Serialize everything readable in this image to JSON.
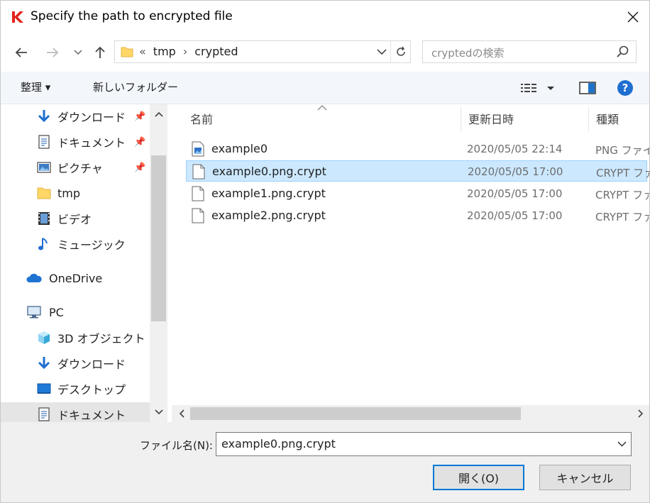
{
  "window": {
    "title": "Specify the path to encrypted file",
    "logo_color": "#e2231a",
    "accent_color": "#0078d7",
    "selection_color": "#cce8ff"
  },
  "nav": {
    "back_icon": "arrow-left-icon",
    "forward_icon": "arrow-right-icon",
    "recent_icon": "chevron-down-icon",
    "up_icon": "arrow-up-icon",
    "path_overflow": "«",
    "path": [
      "tmp",
      "crypted"
    ],
    "path_separator": "›",
    "refresh_icon": "refresh-icon",
    "search_placeholder": "cryptedの検索"
  },
  "toolbar": {
    "organize_label": "整理 ▾",
    "new_folder_label": "新しいフォルダー",
    "view_icon": "view-list-icon",
    "preview_icon": "preview-pane-icon",
    "help_icon": "help-icon"
  },
  "sidebar": {
    "items": [
      {
        "label": "ダウンロード",
        "icon": "download-icon",
        "pinned": true
      },
      {
        "label": "ドキュメント",
        "icon": "document-icon",
        "pinned": true
      },
      {
        "label": "ピクチャ",
        "icon": "pictures-icon",
        "pinned": true
      },
      {
        "label": "tmp",
        "icon": "folder-icon",
        "pinned": false
      },
      {
        "label": "ビデオ",
        "icon": "video-icon",
        "pinned": false
      },
      {
        "label": "ミュージック",
        "icon": "music-icon",
        "pinned": false
      },
      {
        "label": "OneDrive",
        "icon": "cloud-icon",
        "pinned": false
      },
      {
        "label": "PC",
        "icon": "computer-icon",
        "pinned": false
      },
      {
        "label": "3D オブジェクト",
        "icon": "cube-icon",
        "pinned": false
      },
      {
        "label": "ダウンロード",
        "icon": "download-icon",
        "pinned": false
      },
      {
        "label": "デスクトップ",
        "icon": "desktop-icon",
        "pinned": false
      },
      {
        "label": "ドキュメント",
        "icon": "document-icon",
        "pinned": false,
        "selected": true
      }
    ]
  },
  "filelist": {
    "columns": [
      "名前",
      "更新日時",
      "種類"
    ],
    "rows": [
      {
        "name": "example0",
        "date": "2020/05/05 22:14",
        "type": "PNG ファイル",
        "icon": "image-file-icon",
        "selected": false
      },
      {
        "name": "example0.png.crypt",
        "date": "2020/05/05 17:00",
        "type": "CRYPT ファイル",
        "icon": "file-icon",
        "selected": true
      },
      {
        "name": "example1.png.crypt",
        "date": "2020/05/05 17:00",
        "type": "CRYPT ファイル",
        "icon": "file-icon",
        "selected": false
      },
      {
        "name": "example2.png.crypt",
        "date": "2020/05/05 17:00",
        "type": "CRYPT ファイル",
        "icon": "file-icon",
        "selected": false
      }
    ]
  },
  "footer": {
    "filename_label": "ファイル名(N):",
    "filename_value": "example0.png.crypt",
    "open_label": "開く(O)",
    "cancel_label": "キャンセル"
  }
}
